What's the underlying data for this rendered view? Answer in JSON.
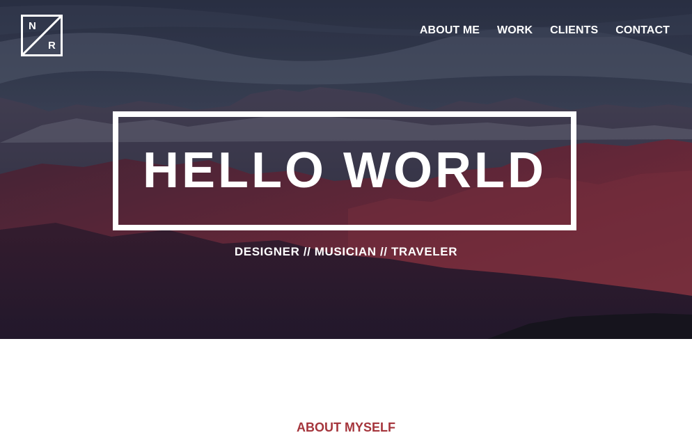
{
  "logo": {
    "letter_top": "N",
    "letter_bottom": "R"
  },
  "nav": {
    "items": [
      {
        "label": "ABOUT ME"
      },
      {
        "label": "WORK"
      },
      {
        "label": "CLIENTS"
      },
      {
        "label": "CONTACT"
      }
    ]
  },
  "hero": {
    "title": "HELLO WORLD",
    "subtitle": "DESIGNER // MUSICIAN // TRAVELER"
  },
  "about": {
    "heading": "ABOUT MYSELF"
  },
  "colors": {
    "accent": "#a5353c",
    "hero_sky": "#3d4459",
    "mountain_red": "#7a2636"
  }
}
